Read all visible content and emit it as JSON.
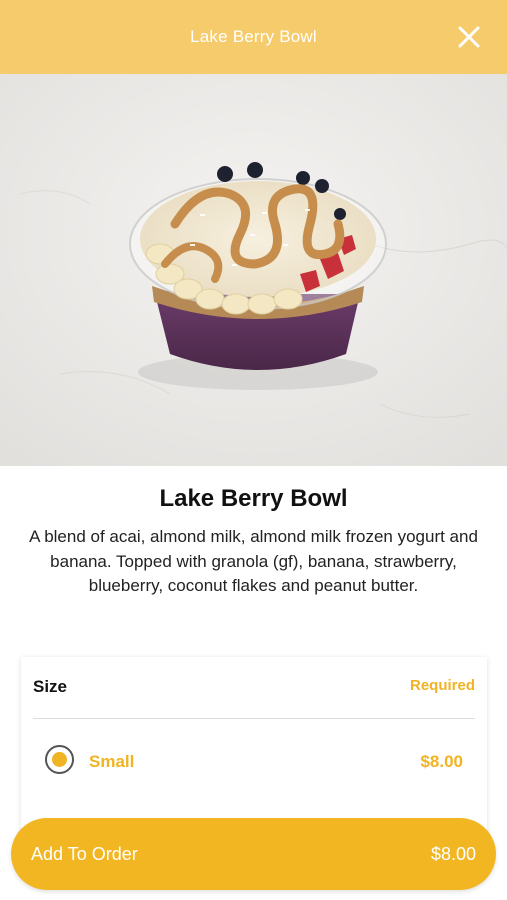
{
  "header": {
    "title": "Lake Berry Bowl",
    "close_icon": "close-icon"
  },
  "hero": {
    "image": "acai-bowl-photo"
  },
  "product": {
    "name": "Lake Berry Bowl",
    "description": "A blend of acai, almond milk, almond milk frozen yogurt and banana. Topped with granola (gf), banana, strawberry, blueberry, coconut flakes and peanut butter."
  },
  "options_card": {
    "group_label": "Size",
    "required_label": "Required",
    "options": [
      {
        "label": "Small",
        "price": "$8.00",
        "selected": true
      }
    ]
  },
  "footer": {
    "add_label": "Add To Order",
    "total": "$8.00"
  },
  "colors": {
    "header_bg": "#f6cb6b",
    "accent": "#f0b323",
    "button_bg": "#f2b623"
  }
}
